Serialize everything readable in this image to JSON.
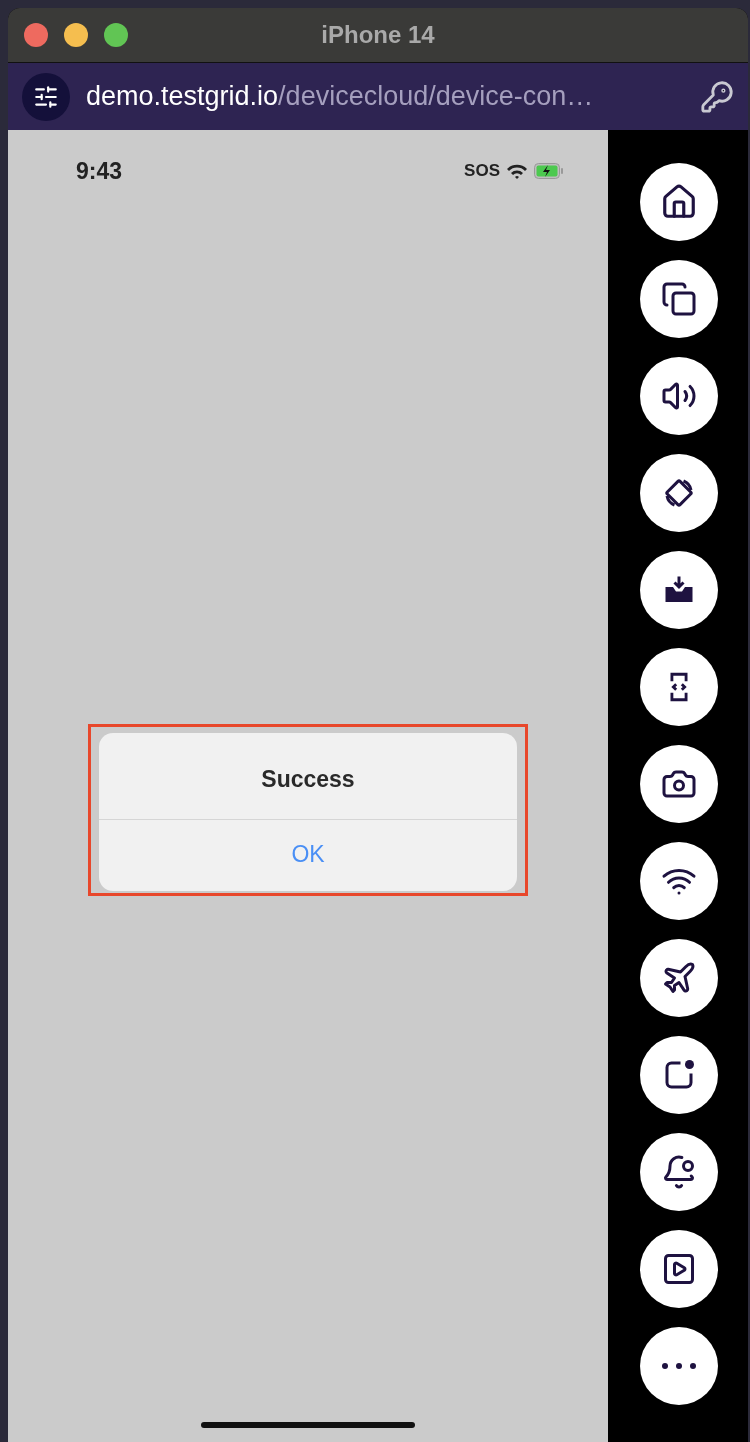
{
  "window": {
    "title": "iPhone 14"
  },
  "address_bar": {
    "host": "demo.testgrid.io",
    "path": "/devicecloud/device-con…"
  },
  "status_bar": {
    "time": "9:43",
    "carrier": "SOS"
  },
  "alert": {
    "title": "Success",
    "button": "OK",
    "highlighted": true
  },
  "controls": [
    {
      "kind": "home"
    },
    {
      "kind": "switch"
    },
    {
      "kind": "volume"
    },
    {
      "kind": "rotate"
    },
    {
      "kind": "install"
    },
    {
      "kind": "inspect"
    },
    {
      "kind": "camera"
    },
    {
      "kind": "wifi"
    },
    {
      "kind": "airplane"
    },
    {
      "kind": "notification"
    },
    {
      "kind": "bell"
    },
    {
      "kind": "record"
    },
    {
      "kind": "more"
    }
  ]
}
